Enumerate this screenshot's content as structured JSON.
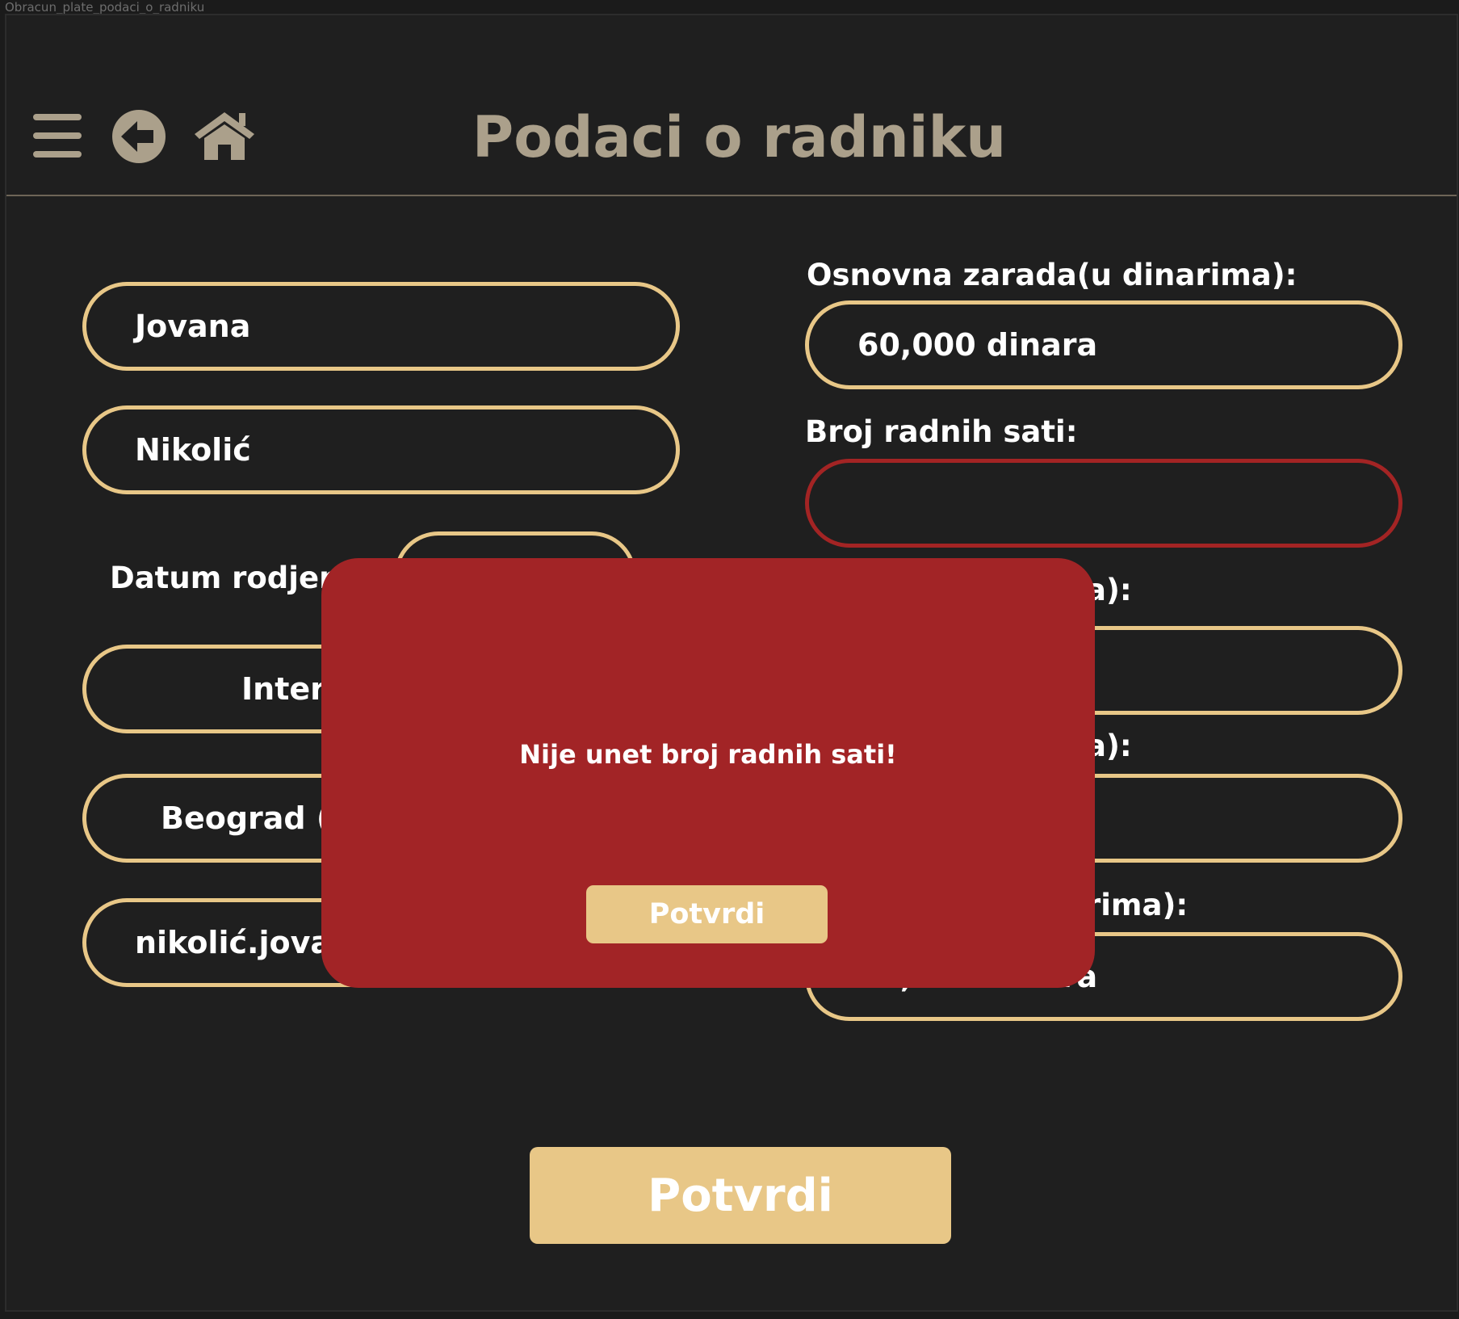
{
  "window": {
    "title": "Obracun_plate_podaci_o_radniku"
  },
  "header": {
    "title": "Podaci o radniku",
    "icons": [
      "menu-icon",
      "back-arrow-icon",
      "home-icon"
    ]
  },
  "left_column": {
    "first_name": "Jovana",
    "last_name": "Nikolić",
    "birth_date_label": "Datum rodjen",
    "position_value": "Interr",
    "city_value": "Beograd (S",
    "email_value": "nikolić.jovan"
  },
  "right_column": {
    "base_salary_label": "Osnovna zarada(u dinarima):",
    "base_salary_value": "60,000 dinara",
    "hours_label": "Broj radnih sati:",
    "hours_value": "",
    "field3_label_tail": "a):",
    "field4_label_tail": "a):",
    "field5_label_tail": "rima):",
    "field5_value": "55,000 dinara"
  },
  "actions": {
    "confirm_label": "Potvrdi"
  },
  "modal": {
    "message": "Nije unet broj radnih sati!",
    "confirm_label": "Potvrdi"
  },
  "colors": {
    "background": "#1f1f1f",
    "accent_gold": "#e8c787",
    "error_red": "#a22426",
    "header_text": "#aba08b"
  }
}
